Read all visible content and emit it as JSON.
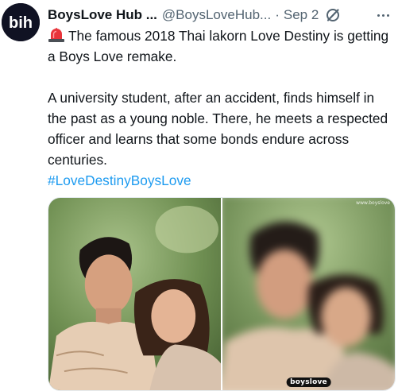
{
  "avatar": {
    "text": "bih",
    "icon": "boyslove-hub-logo",
    "bg": "#101223"
  },
  "author": {
    "name": "BoysLove Hub ...",
    "handle": "@BoysLoveHub...",
    "separator": "·",
    "date": "Sep 2"
  },
  "tweet": {
    "intro_icon": "rotating-light-emoji",
    "line1": "The famous 2018 Thai lakorn Love Destiny is getting a Boys Love remake.",
    "line2": "A university student, after an accident, finds himself in the past as a young noble. There, he meets a respected officer and learns that some bonds endure across centuries.",
    "hashtag": "#LoveDestinyBoysLove"
  },
  "media": {
    "watermark_top": "www.boyslove",
    "watermark_bottom": "boyslove"
  },
  "colors": {
    "link": "#1d9bf0",
    "secondary": "#536471",
    "text": "#0f1419"
  }
}
